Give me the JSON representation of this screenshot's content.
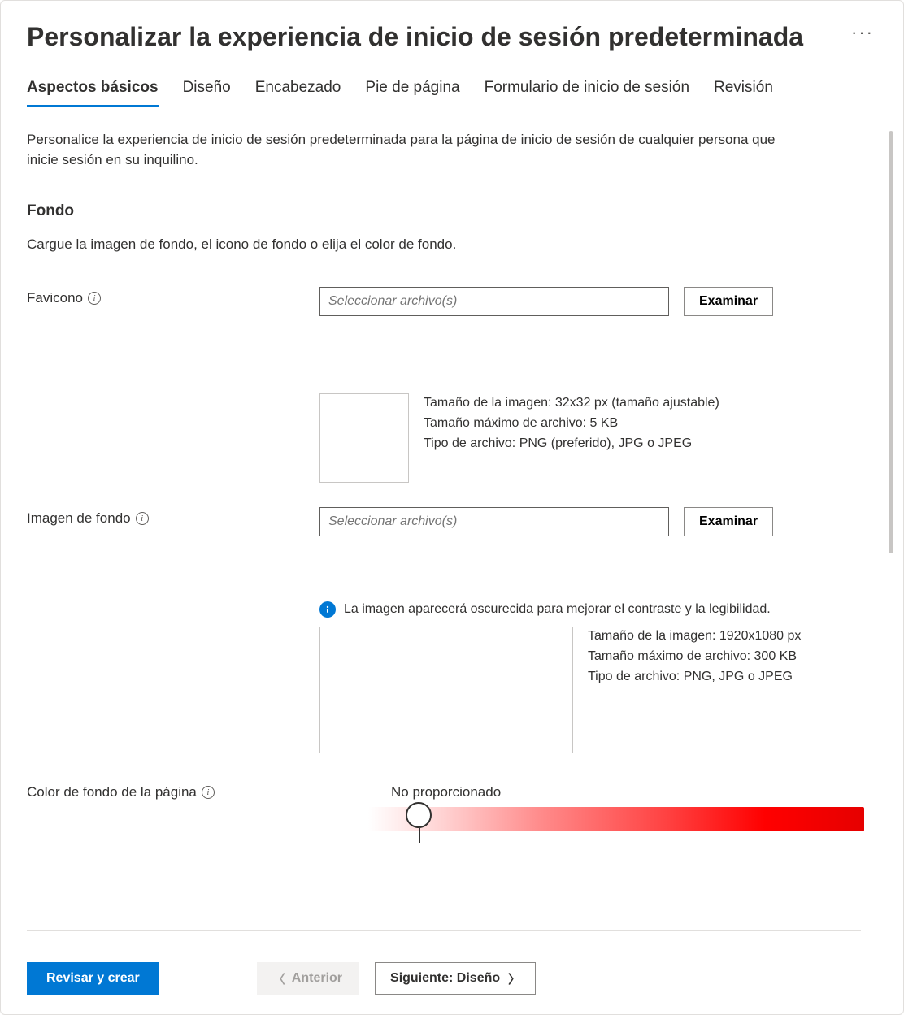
{
  "header": {
    "title": "Personalizar la experiencia de inicio de sesión predeterminada"
  },
  "tabs": {
    "items": [
      {
        "label": "Aspectos básicos",
        "active": true
      },
      {
        "label": "Diseño"
      },
      {
        "label": "Encabezado"
      },
      {
        "label": "Pie de página"
      },
      {
        "label": "Formulario de inicio de sesión"
      },
      {
        "label": "Revisión"
      }
    ]
  },
  "intro": "Personalice la experiencia de inicio de sesión predeterminada para la página de inicio de sesión de cualquier persona que inicie sesión en su inquilino.",
  "section": {
    "title": "Fondo",
    "desc": "Cargue la imagen de fondo, el icono de fondo o elija el color de fondo."
  },
  "favicon": {
    "label": "Favicono",
    "placeholder": "Seleccionar archivo(s)",
    "browse": "Examinar",
    "spec1": "Tamaño de la imagen: 32x32 px (tamaño ajustable)",
    "spec2": "Tamaño máximo de archivo: 5 KB",
    "spec3": "Tipo de archivo: PNG (preferido), JPG o JPEG"
  },
  "background": {
    "label": "Imagen de fondo",
    "placeholder": "Seleccionar archivo(s)",
    "browse": "Examinar",
    "info_msg": "La imagen aparecerá oscurecida para mejorar el contraste y la legibilidad.",
    "spec1": "Tamaño de la imagen: 1920x1080 px",
    "spec2": "Tamaño máximo de archivo: 300 KB",
    "spec3": "Tipo de archivo: PNG, JPG o JPEG"
  },
  "page_color": {
    "label": "Color de fondo de la página",
    "value": "No proporcionado"
  },
  "footer": {
    "review": "Revisar y crear",
    "prev": "Anterior",
    "next": "Siguiente: Diseño"
  }
}
